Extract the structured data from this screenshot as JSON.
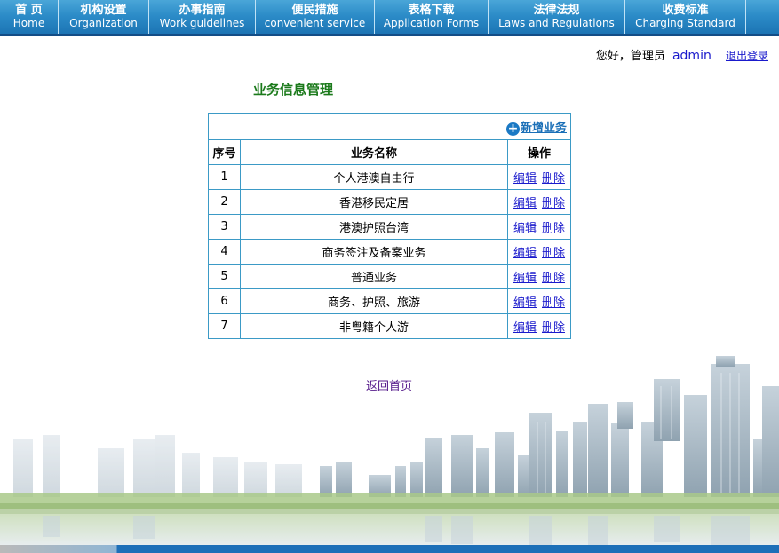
{
  "nav": [
    {
      "zh": "首 页",
      "en": "Home"
    },
    {
      "zh": "机构设置",
      "en": "Organization"
    },
    {
      "zh": "办事指南",
      "en": "Work guidelines"
    },
    {
      "zh": "便民措施",
      "en": "convenient service"
    },
    {
      "zh": "表格下载",
      "en": "Application Forms"
    },
    {
      "zh": "法律法规",
      "en": "Laws and Regulations"
    },
    {
      "zh": "收费标准",
      "en": "Charging Standard"
    }
  ],
  "user": {
    "greeting": "您好，管理员",
    "name": "admin",
    "logout": "退出登录"
  },
  "page_title": "业务信息管理",
  "table": {
    "add_label": "新增业务",
    "headers": [
      "序号",
      "业务名称",
      "操作"
    ],
    "rows": [
      {
        "no": "1",
        "name": "个人港澳自由行"
      },
      {
        "no": "2",
        "name": "香港移民定居"
      },
      {
        "no": "3",
        "name": "港澳护照台湾"
      },
      {
        "no": "4",
        "name": "商务签注及备案业务"
      },
      {
        "no": "5",
        "name": "普通业务"
      },
      {
        "no": "6",
        "name": "商务、护照、旅游"
      },
      {
        "no": "7",
        "name": "非粤籍个人游"
      }
    ],
    "edit_label": "编辑",
    "delete_label": "删除"
  },
  "back_home": "返回首页",
  "colors": {
    "nav_blue": "#2c8cc8",
    "title_green": "#1b7a1b",
    "table_border": "#3b9ac6",
    "link_blue": "#1a1acc"
  },
  "icons": {
    "add": "plus-circle-icon"
  }
}
